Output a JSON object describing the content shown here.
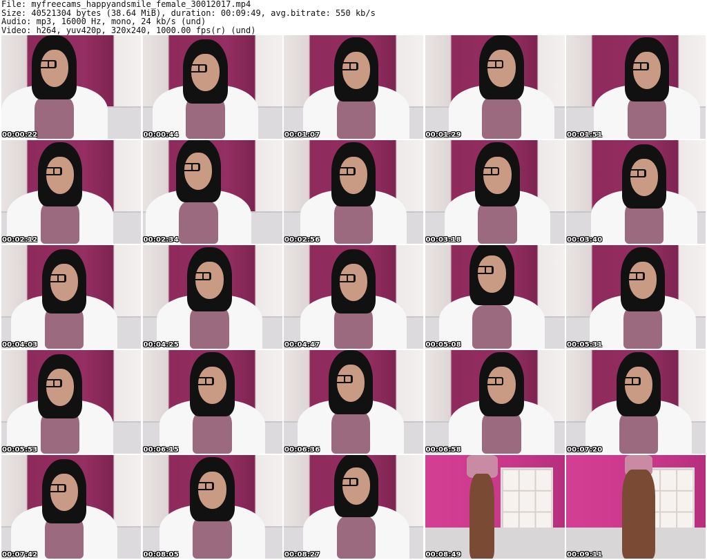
{
  "header": {
    "line1": "File: myfreecams_happyandsmile_female_30012017.mp4",
    "line2": "Size: 40521304 bytes (38.64 MiB), duration: 00:09:49, avg.bitrate: 550 kb/s",
    "line3": "Audio: mp3, 16000 Hz, mono, 24 kb/s (und)",
    "line4": "Video: h264, yuv420p, 320x240, 1000.00 fps(r) (und)"
  },
  "thumbnails": [
    {
      "time": "00:00:22"
    },
    {
      "time": "00:00:44"
    },
    {
      "time": "00:01:07"
    },
    {
      "time": "00:01:29"
    },
    {
      "time": "00:01:51"
    },
    {
      "time": "00:02:12"
    },
    {
      "time": "00:02:34"
    },
    {
      "time": "00:02:56"
    },
    {
      "time": "00:03:18"
    },
    {
      "time": "00:03:40"
    },
    {
      "time": "00:04:03"
    },
    {
      "time": "00:04:25"
    },
    {
      "time": "00:04:47"
    },
    {
      "time": "00:05:08"
    },
    {
      "time": "00:05:31"
    },
    {
      "time": "00:05:53"
    },
    {
      "time": "00:06:15"
    },
    {
      "time": "00:06:36"
    },
    {
      "time": "00:06:58"
    },
    {
      "time": "00:07:20"
    },
    {
      "time": "00:07:42"
    },
    {
      "time": "00:08:05"
    },
    {
      "time": "00:08:27"
    },
    {
      "time": "00:08:49"
    },
    {
      "time": "00:09:11"
    }
  ]
}
